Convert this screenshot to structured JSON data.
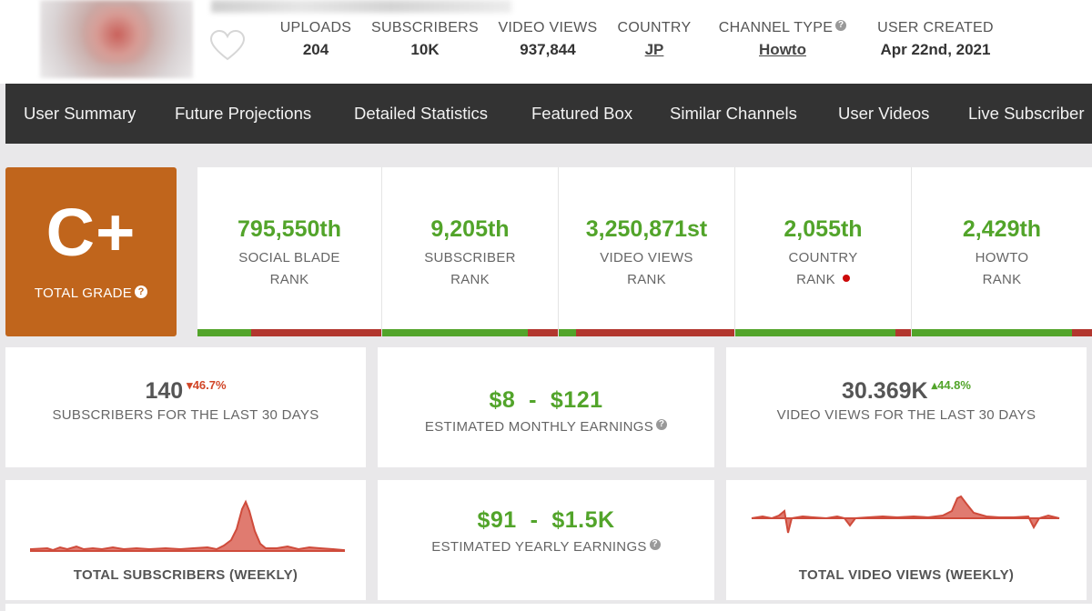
{
  "header": {
    "stats": [
      {
        "label": "UPLOADS",
        "value": "204"
      },
      {
        "label": "SUBSCRIBERS",
        "value": "10K"
      },
      {
        "label": "VIDEO VIEWS",
        "value": "937,844"
      },
      {
        "label": "COUNTRY",
        "value": "JP"
      },
      {
        "label": "CHANNEL TYPE",
        "value": "Howto"
      },
      {
        "label": "USER CREATED",
        "value": "Apr 22nd, 2021"
      }
    ],
    "help_glyph": "?"
  },
  "nav": {
    "items": [
      "User Summary",
      "Future Projections",
      "Detailed Statistics",
      "Featured Box",
      "Similar Channels",
      "User Videos",
      "Live Subscriber"
    ]
  },
  "grade": {
    "value": "C+",
    "label": "TOTAL GRADE",
    "help_glyph": "?"
  },
  "ranks": [
    {
      "value": "795,550th",
      "line1": "SOCIAL BLADE",
      "line2": "RANK",
      "percentile": 0.29
    },
    {
      "value": "9,205th",
      "line1": "SUBSCRIBER",
      "line2": "RANK",
      "percentile": 0.83
    },
    {
      "value": "3,250,871st",
      "line1": "VIDEO VIEWS",
      "line2": "RANK",
      "percentile": 0.1
    },
    {
      "value": "2,055th",
      "line1": "COUNTRY",
      "line2": "RANK",
      "percentile": 0.91
    },
    {
      "value": "2,429th",
      "line1": "HOWTO",
      "line2": "RANK",
      "percentile": 0.89
    }
  ],
  "cards": {
    "subs30": {
      "value": "140",
      "change": "46.7%",
      "direction": "down",
      "label": "SUBSCRIBERS FOR THE LAST 30 DAYS"
    },
    "monthly": {
      "low": "$8",
      "sep": "-",
      "high": "$121",
      "label": "ESTIMATED MONTHLY EARNINGS"
    },
    "views30": {
      "value": "30.369K",
      "change": "44.8%",
      "direction": "up",
      "label": "VIDEO VIEWS FOR THE LAST 30 DAYS"
    },
    "yearly": {
      "low": "$91",
      "sep": "-",
      "high": "$1.5K",
      "label": "ESTIMATED YEARLY EARNINGS"
    },
    "subs_chart_title": "TOTAL SUBSCRIBERS (WEEKLY)",
    "views_chart_title": "TOTAL VIDEO VIEWS (WEEKLY)"
  },
  "colors": {
    "nav_bg": "#333333",
    "grade_bg": "#c0651c",
    "green": "#52a42a",
    "red": "#b2362e",
    "chart_line": "#cf4b3b",
    "chart_fill": "#e07b70"
  },
  "icons": [
    "heart-icon",
    "help-icon",
    "arrow-down-icon",
    "arrow-up-icon",
    "japan-flag-icon"
  ]
}
